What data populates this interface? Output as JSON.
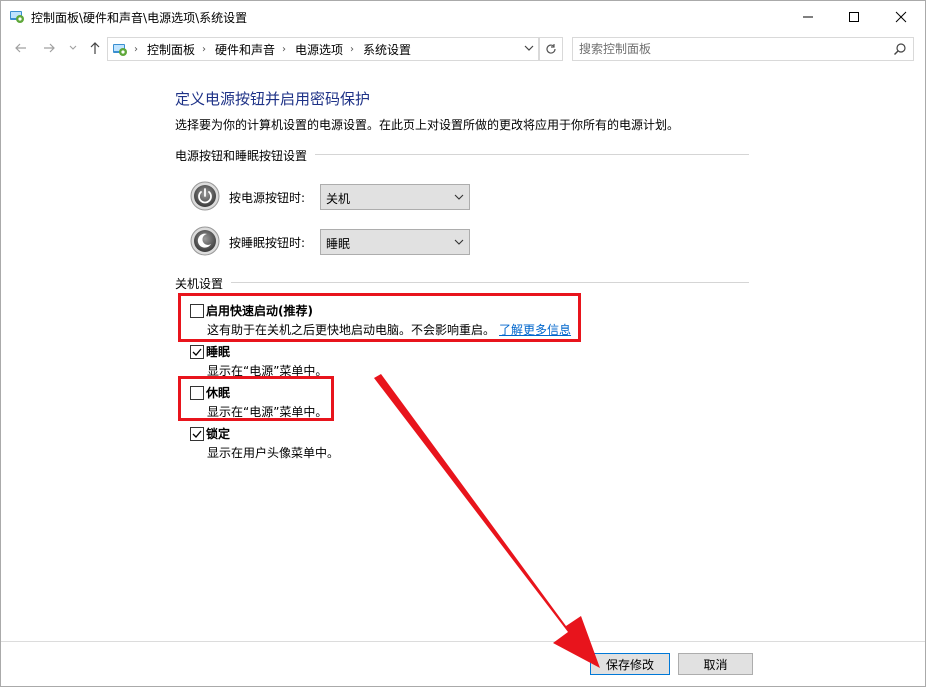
{
  "window": {
    "title": "控制面板\\硬件和声音\\电源选项\\系统设置"
  },
  "address": {
    "crumbs": [
      "控制面板",
      "硬件和声音",
      "电源选项",
      "系统设置"
    ],
    "search_placeholder": "搜索控制面板"
  },
  "main": {
    "title": "定义电源按钮并启用密码保护",
    "description": "选择要为你的计算机设置的电源设置。在此页上对设置所做的更改将应用于你所有的电源计划。",
    "power_section": {
      "heading": "电源按钮和睡眠按钮设置",
      "power_button": {
        "label": "按电源按钮时:",
        "value": "关机"
      },
      "sleep_button": {
        "label": "按睡眠按钮时:",
        "value": "睡眠"
      }
    },
    "shutdown_section": {
      "heading": "关机设置",
      "options": [
        {
          "label": "启用快速启动(推荐)",
          "desc": "这有助于在关机之后更快地启动电脑。不会影响重启。",
          "link": "了解更多信息",
          "checked": false
        },
        {
          "label": "睡眠",
          "desc": "显示在“电源”菜单中。",
          "checked": true
        },
        {
          "label": "休眠",
          "desc": "显示在“电源”菜单中。",
          "checked": false
        },
        {
          "label": "锁定",
          "desc": "显示在用户头像菜单中。",
          "checked": true
        }
      ]
    }
  },
  "footer": {
    "save_label": "保存修改",
    "cancel_label": "取消"
  },
  "colors": {
    "title_blue": "#1e3287",
    "link_blue": "#0066cc",
    "highlight_red": "#e8141c"
  }
}
